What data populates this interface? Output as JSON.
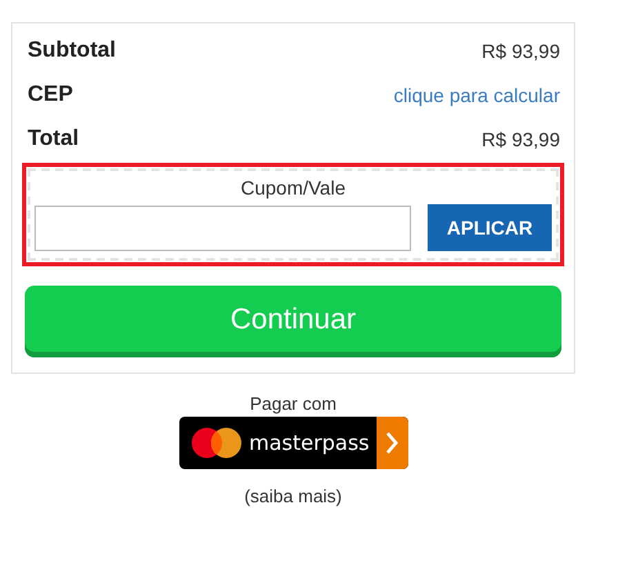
{
  "summary": [
    {
      "label": "Subtotal",
      "value": "R$ 93,99",
      "kind": "amount"
    },
    {
      "label": "CEP",
      "value": "clique para calcular",
      "kind": "link"
    },
    {
      "label": "Total",
      "value": "R$ 93,99",
      "kind": "amount"
    }
  ],
  "coupon": {
    "label": "Cupom/Vale",
    "button": "APLICAR",
    "highlighted": true
  },
  "continue_button": "Continuar",
  "masterpass": {
    "caption": "Pagar com",
    "brand": "masterpass",
    "more_link": "(saiba mais)"
  }
}
